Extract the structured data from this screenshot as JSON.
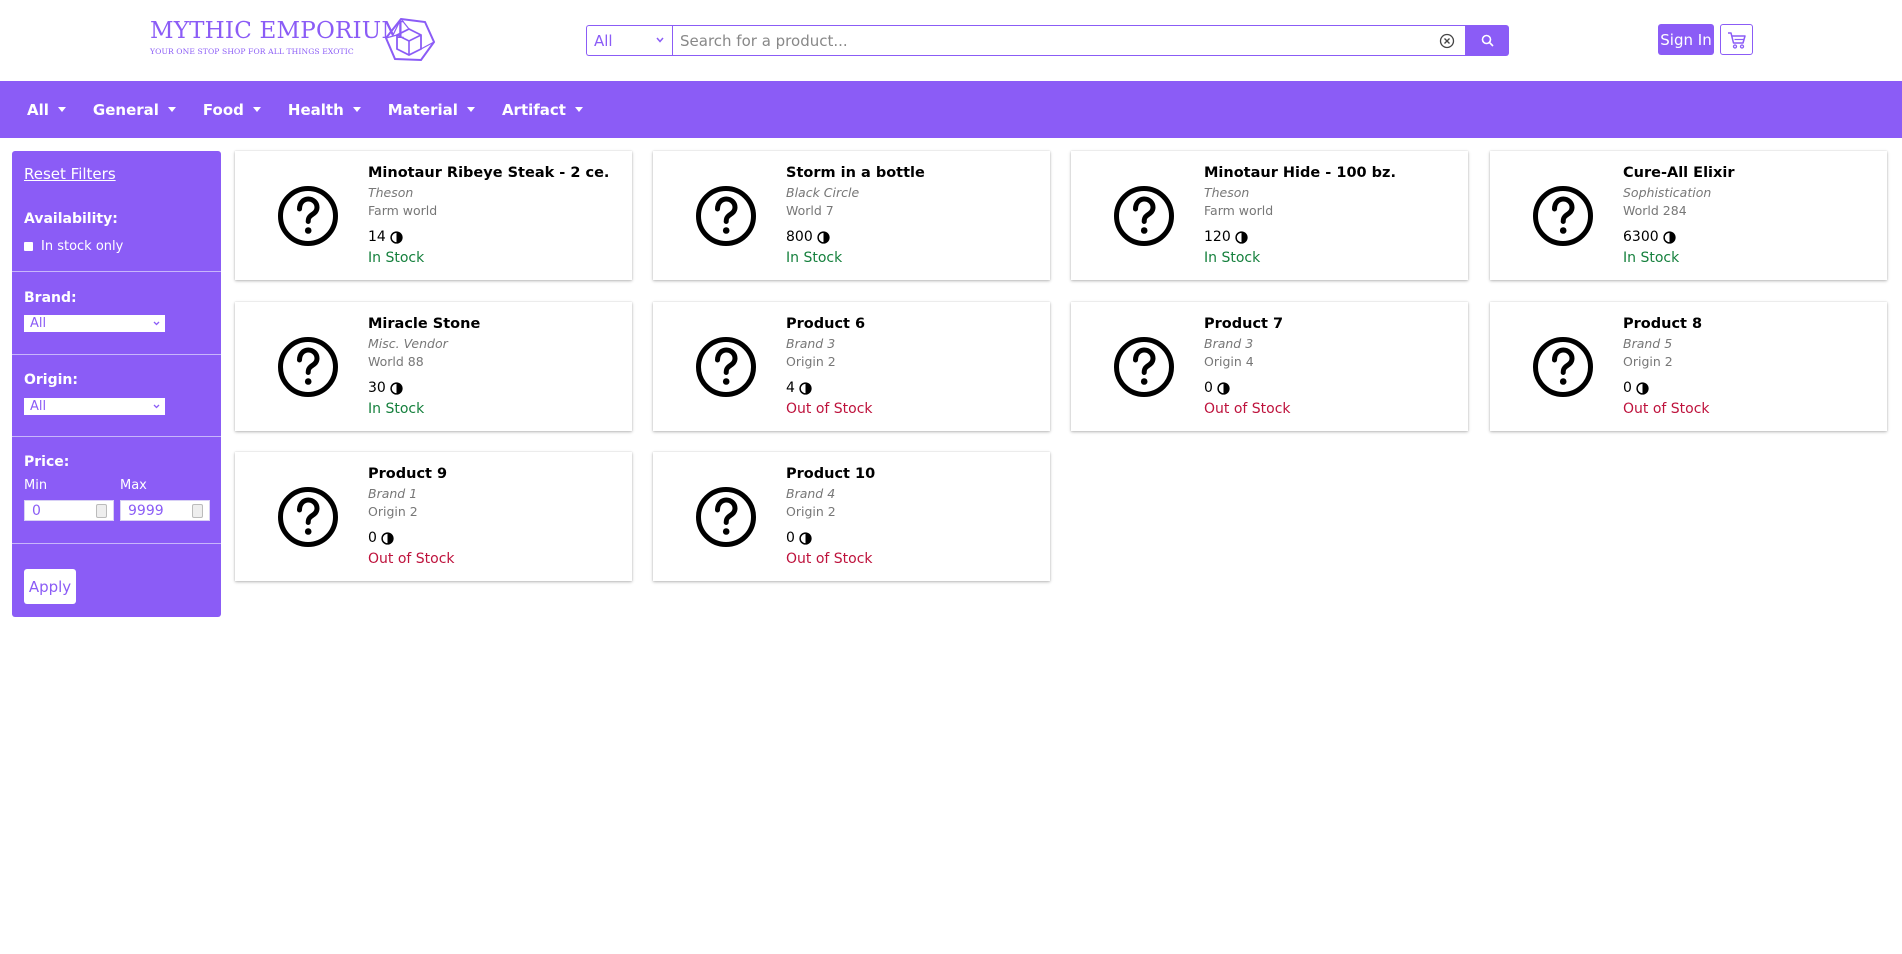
{
  "header": {
    "logo_title": "MYTHIC EMPORIUM",
    "logo_subtitle": "YOUR ONE STOP SHOP FOR ALL THINGS EXOTIC",
    "logo_icon": "cube-icon",
    "search": {
      "category_value": "All",
      "placeholder": "Search for a product...",
      "search_icon": "search-icon",
      "clear_icon": "clear-circle-icon"
    },
    "signin_label": "Sign In",
    "cart_icon": "cart-icon"
  },
  "nav": {
    "items": [
      {
        "label": "All"
      },
      {
        "label": "General"
      },
      {
        "label": "Food"
      },
      {
        "label": "Health"
      },
      {
        "label": "Material"
      },
      {
        "label": "Artifact"
      }
    ]
  },
  "sidebar": {
    "reset_label": "Reset Filters",
    "availability_title": "Availability:",
    "in_stock_label": "In stock only",
    "in_stock_checked": false,
    "brand_title": "Brand:",
    "brand_value": "All",
    "origin_title": "Origin:",
    "origin_value": "All",
    "price_title": "Price:",
    "min_label": "Min",
    "min_value": "0",
    "max_label": "Max",
    "max_value": "9999",
    "apply_label": "Apply"
  },
  "products": [
    {
      "name": "Minotaur Ribeye Steak - 2 ce.",
      "brand": "Theson",
      "origin": "Farm world",
      "price": "14",
      "stock": "In Stock",
      "in_stock": true
    },
    {
      "name": "Storm in a bottle",
      "brand": "Black Circle",
      "origin": "World 7",
      "price": "800",
      "stock": "In Stock",
      "in_stock": true
    },
    {
      "name": "Minotaur Hide - 100 bz.",
      "brand": "Theson",
      "origin": "Farm world",
      "price": "120",
      "stock": "In Stock",
      "in_stock": true
    },
    {
      "name": "Cure-All Elixir",
      "brand": "Sophistication",
      "origin": "World 284",
      "price": "6300",
      "stock": "In Stock",
      "in_stock": true
    },
    {
      "name": "Miracle Stone",
      "brand": "Misc. Vendor",
      "origin": "World 88",
      "price": "30",
      "stock": "In Stock",
      "in_stock": true
    },
    {
      "name": "Product 6",
      "brand": "Brand 3",
      "origin": "Origin 2",
      "price": "4",
      "stock": "Out of Stock",
      "in_stock": false
    },
    {
      "name": "Product 7",
      "brand": "Brand 3",
      "origin": "Origin 4",
      "price": "0",
      "stock": "Out of Stock",
      "in_stock": false
    },
    {
      "name": "Product 8",
      "brand": "Brand 5",
      "origin": "Origin 2",
      "price": "0",
      "stock": "Out of Stock",
      "in_stock": false
    },
    {
      "name": "Product 9",
      "brand": "Brand 1",
      "origin": "Origin 2",
      "price": "0",
      "stock": "Out of Stock",
      "in_stock": false
    },
    {
      "name": "Product 10",
      "brand": "Brand 4",
      "origin": "Origin 2",
      "price": "0",
      "stock": "Out of Stock",
      "in_stock": false
    }
  ],
  "colors": {
    "accent": "#8b5cf6",
    "in_stock": "#15803d",
    "out_of_stock": "#be123c"
  }
}
